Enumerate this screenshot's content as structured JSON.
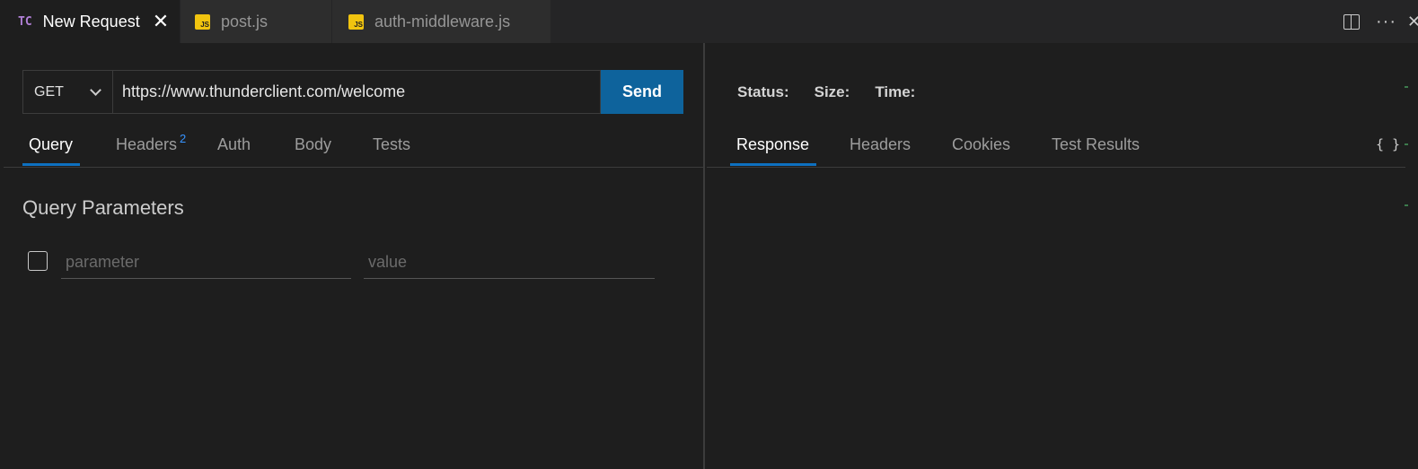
{
  "editor_tabs": [
    {
      "icon": "TC",
      "label": "New Request",
      "active": true
    },
    {
      "icon": "JS",
      "label": "post.js",
      "active": false
    },
    {
      "icon": "JS",
      "label": "auth-middleware.js",
      "active": false
    }
  ],
  "request": {
    "method": "GET",
    "url": "https://www.thunderclient.com/welcome",
    "send_label": "Send"
  },
  "request_tabs": {
    "query": "Query",
    "headers": "Headers",
    "headers_count": "2",
    "auth": "Auth",
    "body": "Body",
    "tests": "Tests"
  },
  "query_params": {
    "title": "Query Parameters",
    "parameter_placeholder": "parameter",
    "value_placeholder": "value"
  },
  "response_meta": {
    "status_label": "Status:",
    "size_label": "Size:",
    "time_label": "Time:"
  },
  "response_tabs": {
    "response": "Response",
    "headers": "Headers",
    "cookies": "Cookies",
    "test_results": "Test Results"
  },
  "format_button": "{ }",
  "colors": {
    "accent": "#0e639c",
    "tab_underline": "#0e70c0",
    "badge": "#3794ff",
    "tc_icon": "#b180d7",
    "js_icon": "#f1c40f"
  }
}
